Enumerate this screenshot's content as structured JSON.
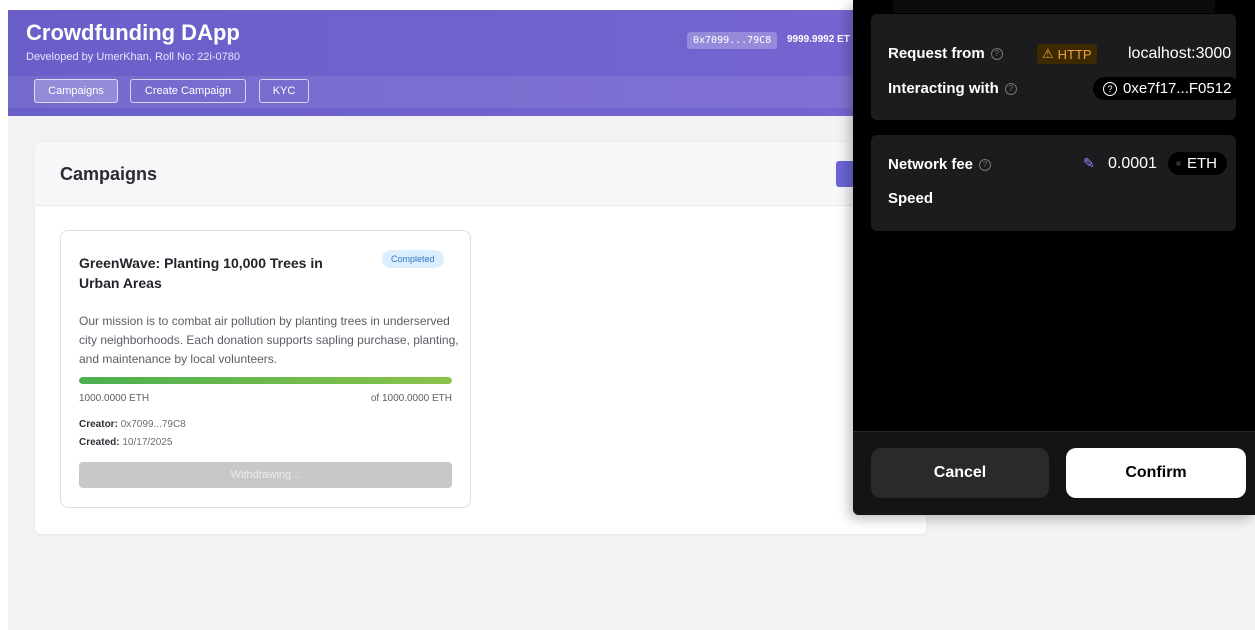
{
  "app": {
    "title": "Crowdfunding DApp",
    "subtitle": "Developed by UmerKhan, Roll No: 22i-0780",
    "wallet_address": "0x7099...79C8",
    "wallet_balance": "9999.9992 ET"
  },
  "nav": {
    "tabs": [
      {
        "label": "Campaigns",
        "active": true
      },
      {
        "label": "Create Campaign",
        "active": false
      },
      {
        "label": "KYC",
        "active": false
      }
    ]
  },
  "main": {
    "title": "Campaigns",
    "cards": [
      {
        "title": "GreenWave: Planting 10,000 Trees in Urban Areas",
        "status": "Completed",
        "description": "Our mission is to combat air pollution by planting trees in underserved city neighborhoods. Each donation supports sapling purchase, planting, and maintenance by local volunteers.",
        "progress_percent": 100,
        "raised": "1000.0000 ETH",
        "goal": "of 1000.0000 ETH",
        "creator_label": "Creator:",
        "creator_value": "0x7099...79C8",
        "created_label": "Created:",
        "created_value": "10/17/2025",
        "action_label": "Withdrawing..."
      }
    ]
  },
  "wallet_popup": {
    "request_from_label": "Request from",
    "http_label": "HTTP",
    "origin": "localhost:3000",
    "interacting_with_label": "Interacting with",
    "contract": "0xe7f17...F0512",
    "network_fee_label": "Network fee",
    "fee_amount": "0.0001",
    "fee_currency": "ETH",
    "speed_label": "Speed",
    "cancel_label": "Cancel",
    "confirm_label": "Confirm"
  },
  "colors": {
    "header_gradient_start": "#6a5fc9",
    "header_gradient_end": "#7b67d2",
    "progress_start": "#4caf50",
    "progress_end": "#8bc34a",
    "badge_bg": "#dbeefe",
    "warning": "#f0a23a"
  }
}
